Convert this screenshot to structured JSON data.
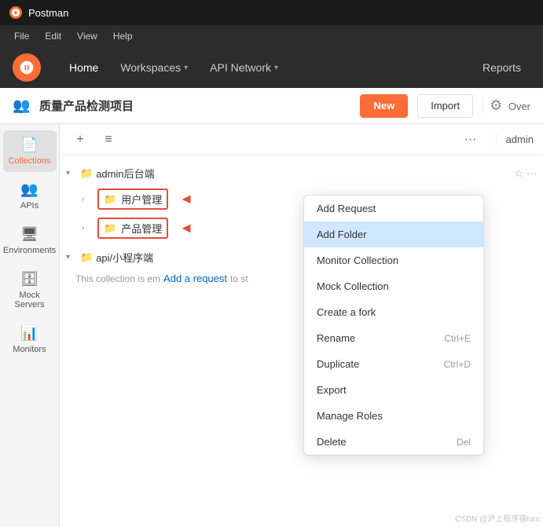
{
  "titlebar": {
    "logo_alt": "postman-logo",
    "app_name": "Postman"
  },
  "menubar": {
    "items": [
      "File",
      "Edit",
      "View",
      "Help"
    ]
  },
  "header": {
    "logo_alt": "postman-icon",
    "nav_items": [
      {
        "label": "Home",
        "has_chevron": false
      },
      {
        "label": "Workspaces",
        "has_chevron": true
      },
      {
        "label": "API Network",
        "has_chevron": true
      }
    ],
    "reports_label": "Reports"
  },
  "workspace_bar": {
    "title": "质量产品检测项目",
    "btn_new": "New",
    "btn_import": "Import",
    "over_label": "Over"
  },
  "sidebar": {
    "items": [
      {
        "label": "Collections",
        "icon": "📄"
      },
      {
        "label": "APIs",
        "icon": "👥"
      },
      {
        "label": "Environments",
        "icon": "🖥"
      },
      {
        "label": "Mock Servers",
        "icon": "🗄"
      },
      {
        "label": "Monitors",
        "icon": "📊"
      }
    ]
  },
  "toolbar": {
    "add_icon": "+",
    "filter_icon": "≡",
    "dots_icon": "···"
  },
  "tree": {
    "collection1": {
      "name": "admin后台端",
      "folders": [
        {
          "name": "用户管理",
          "has_box": true
        },
        {
          "name": "产品管理",
          "has_box": true
        }
      ]
    },
    "collection2": {
      "name": "api/小程序端",
      "description": "This collection is em",
      "add_request": "Add a request"
    }
  },
  "context_menu": {
    "items": [
      {
        "label": "Add Request",
        "shortcut": "",
        "highlighted": false
      },
      {
        "label": "Add Folder",
        "shortcut": "",
        "highlighted": true
      },
      {
        "label": "Monitor Collection",
        "shortcut": "",
        "highlighted": false
      },
      {
        "label": "Mock Collection",
        "shortcut": "",
        "highlighted": false
      },
      {
        "label": "Create a fork",
        "shortcut": "",
        "highlighted": false
      },
      {
        "label": "Rename",
        "shortcut": "Ctrl+E",
        "highlighted": false
      },
      {
        "label": "Duplicate",
        "shortcut": "Ctrl+D",
        "highlighted": false
      },
      {
        "label": "Export",
        "shortcut": "",
        "highlighted": false
      },
      {
        "label": "Manage Roles",
        "shortcut": "",
        "highlighted": false
      },
      {
        "label": "Delete",
        "shortcut": "Del",
        "highlighted": false
      }
    ]
  },
  "admin_label": "admin"
}
